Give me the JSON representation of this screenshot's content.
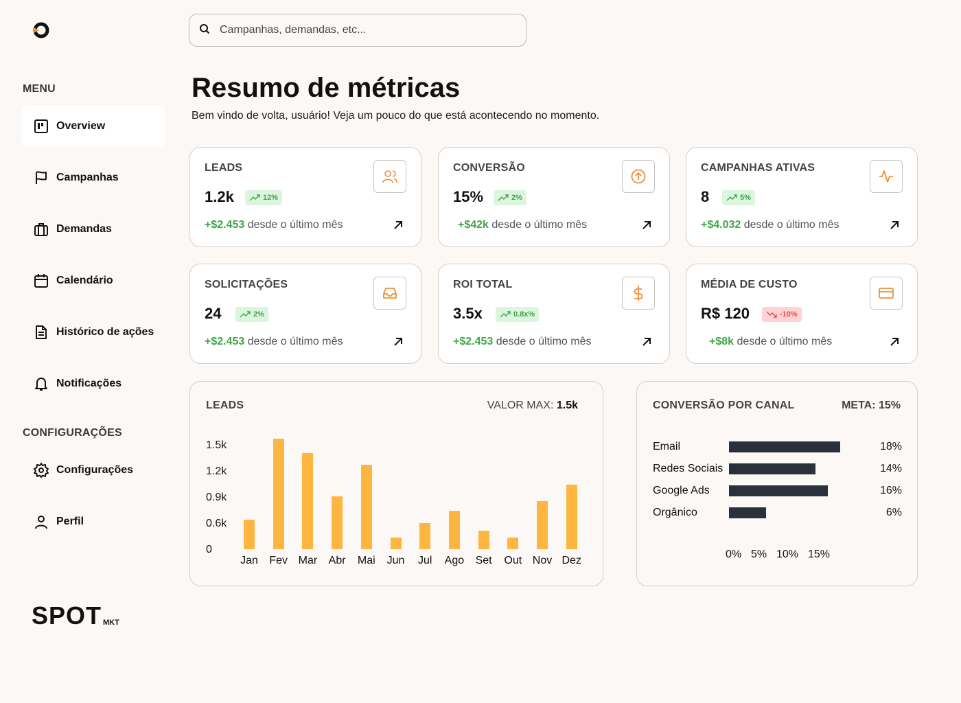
{
  "search": {
    "placeholder": "Campanhas, demandas, etc..."
  },
  "sidebar": {
    "menu_title": "MENU",
    "items": [
      {
        "label": "Overview",
        "icon": "board-icon"
      },
      {
        "label": "Campanhas",
        "icon": "flag-icon"
      },
      {
        "label": "Demandas",
        "icon": "briefcase-icon"
      },
      {
        "label": "Calendário",
        "icon": "calendar-icon"
      },
      {
        "label": "Histórico de ações",
        "icon": "document-icon"
      },
      {
        "label": "Notificações",
        "icon": "bell-icon"
      }
    ],
    "config_title": "CONFIGURAÇÕES",
    "config_items": [
      {
        "label": "Configurações",
        "icon": "gear-icon"
      },
      {
        "label": "Perfil",
        "icon": "user-icon"
      }
    ]
  },
  "brand": {
    "name": "SPOT",
    "suffix": "MKT"
  },
  "header": {
    "title": "Resumo de métricas",
    "subtitle": "Bem vindo de volta, usuário! Veja um pouco do que está acontecendo no momento."
  },
  "colors": {
    "accent": "#f28c38",
    "bar": "#ffb640",
    "dark_bar": "#2a313c",
    "positive": "#3fa548",
    "negative": "#e34a4a"
  },
  "cards": [
    {
      "label": "LEADS",
      "value": "1.2k",
      "badge": "12%",
      "trend": "up",
      "delta": "+$2.453",
      "foot": " desde o último mês",
      "icon": "users-icon"
    },
    {
      "label": "CONVERSÃO",
      "value": "15%",
      "badge": "2%",
      "trend": "up",
      "delta": "+$42k",
      "foot": " desde o último mês",
      "icon": "arrow-up-circle-icon"
    },
    {
      "label": "CAMPANHAS ATIVAS",
      "value": "8",
      "badge": "5%",
      "trend": "up",
      "delta": "+$4.032",
      "foot": " desde o último mês",
      "icon": "activity-icon"
    },
    {
      "label": "SOLICITAÇÕES",
      "value": "24",
      "badge": "2%",
      "trend": "up",
      "delta": "+$2.453",
      "foot": " desde o último mês",
      "icon": "inbox-icon"
    },
    {
      "label": "ROI TOTAL",
      "value": "3.5x",
      "badge": "0.8x%",
      "trend": "up",
      "delta": "+$2.453",
      "foot": " desde o último mês",
      "icon": "dollar-icon"
    },
    {
      "label": "MÉDIA DE CUSTO",
      "value": "R$ 120",
      "badge": "-10%",
      "trend": "down",
      "delta": "+$8k",
      "foot": " desde o último mês",
      "icon": "credit-card-icon"
    }
  ],
  "leads_panel": {
    "title": "LEADS",
    "max_label": "VALOR MAX: ",
    "max_value": "1.5k"
  },
  "channel_panel": {
    "title": "CONVERSÃO POR CANAL",
    "meta": "META: 15%"
  },
  "chart_data": [
    {
      "type": "bar",
      "title": "LEADS",
      "categories": [
        "Jan",
        "Fev",
        "Mar",
        "Abr",
        "Mai",
        "Jun",
        "Jul",
        "Ago",
        "Set",
        "Out",
        "Nov",
        "Dez"
      ],
      "values": [
        0.4,
        1.5,
        1.3,
        0.72,
        1.15,
        0.16,
        0.35,
        0.52,
        0.25,
        0.16,
        0.65,
        0.88
      ],
      "y_ticks": [
        "1.5k",
        "1.2k",
        "0.9k",
        "0.6k",
        "0"
      ],
      "ylim": [
        0,
        1.5
      ]
    },
    {
      "type": "bar",
      "orientation": "horizontal",
      "title": "CONVERSÃO POR CANAL",
      "categories": [
        "Email",
        "Redes Sociais",
        "Google Ads",
        "Orgânico"
      ],
      "values": [
        18,
        14,
        16,
        6
      ],
      "value_labels": [
        "18%",
        "14%",
        "16%",
        "6%"
      ],
      "x_ticks": [
        "0%",
        "5%",
        "10%",
        "15%"
      ],
      "xlim": [
        0,
        20
      ]
    }
  ]
}
